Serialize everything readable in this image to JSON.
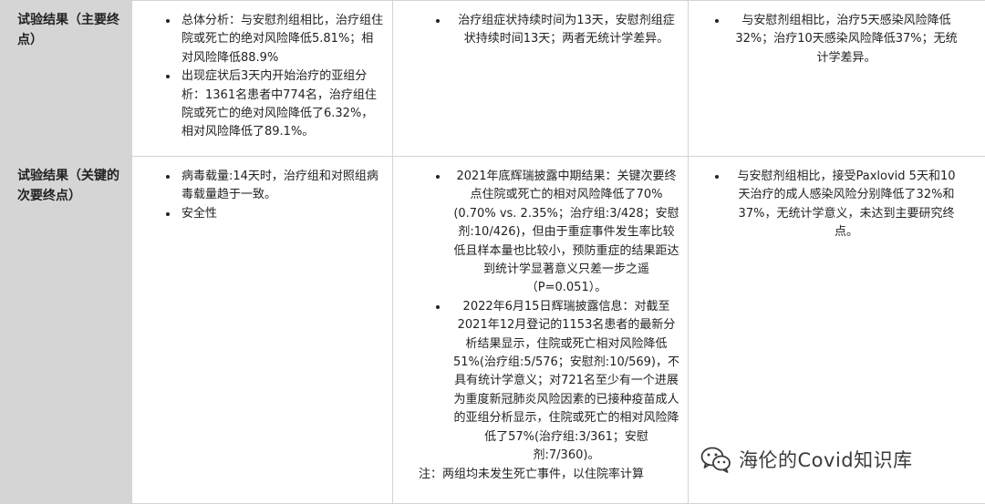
{
  "rows": [
    {
      "label": "试验结果（主要终点）",
      "cells": [
        [
          "总体分析：与安慰剂组相比，治疗组住院或死亡的绝对风险降低5.81%；相对风险降低88.9%",
          "出现症状后3天内开始治疗的亚组分析：1361名患者中774名，治疗组住院或死亡的绝对风险降低了6.32%，相对风险降低了89.1%。"
        ],
        [
          "治疗组症状持续时间为13天，安慰剂组症状持续时间13天；两者无统计学差异。"
        ],
        [
          "与安慰剂组相比，治疗5天感染风险降低32%；治疗10天感染风险降低37%；无统计学差异。"
        ]
      ]
    },
    {
      "label": "试验结果（关键的次要终点）",
      "cells": [
        [
          "病毒载量:14天时，治疗组和对照组病毒载量趋于一致。",
          "安全性"
        ],
        [
          "2021年底辉瑞披露中期结果：关键次要终点住院或死亡的相对风险降低了70%(0.70% vs. 2.35%；治疗组:3/428；安慰剂:10/426)，但由于重症事件发生率比较低且样本量也比较小，预防重症的结果距达到统计学显著意义只差一步之遥（P=0.051）。",
          "2022年6月15日辉瑞披露信息：对截至2021年12月登记的1153名患者的最新分析结果显示，住院或死亡相对风险降低51%(治疗组:5/576；安慰剂:10/569)，不具有统计学意义；对721名至少有一个进展为重度新冠肺炎风险因素的已接种疫苗成人的亚组分析显示，住院或死亡的相对风险降低了57%(治疗组:3/361；安慰剂:7/360)。"
        ],
        [
          "与安慰剂组相比，接受Paxlovid 5天和10天治疗的成人感染风险分别降低了32%和37%，无统计学意义，未达到主要研究终点。"
        ]
      ],
      "note": "注：两组均未发生死亡事件，以住院率计算"
    }
  ],
  "watermark": {
    "text": "海伦的Covid知识库",
    "icon": "wechat-icon"
  }
}
